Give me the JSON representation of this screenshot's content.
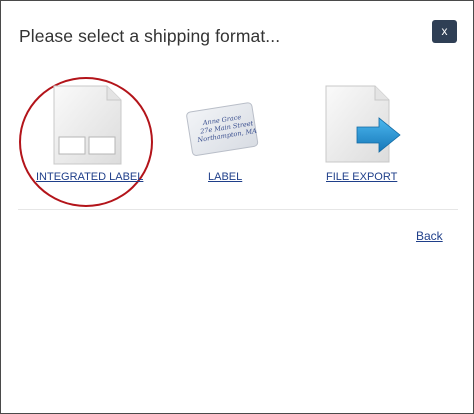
{
  "dialog": {
    "title": "Please select a shipping format...",
    "close_label": "x"
  },
  "options": [
    {
      "label": "INTEGRATED LABEL",
      "icon": "integrated-label-document-icon",
      "highlighted": true
    },
    {
      "label": "LABEL",
      "icon": "address-label-card-icon",
      "address_lines": [
        "Anne Grace",
        "27e Main Street",
        "Northampton, MA"
      ]
    },
    {
      "label": "FILE EXPORT",
      "icon": "file-export-arrow-icon"
    }
  ],
  "footer": {
    "back_label": "Back"
  },
  "colors": {
    "highlight_ring": "#b3141a",
    "close_button_bg": "#2f3f55",
    "link": "#1f3f8a",
    "export_arrow": "#1a8fd0"
  }
}
